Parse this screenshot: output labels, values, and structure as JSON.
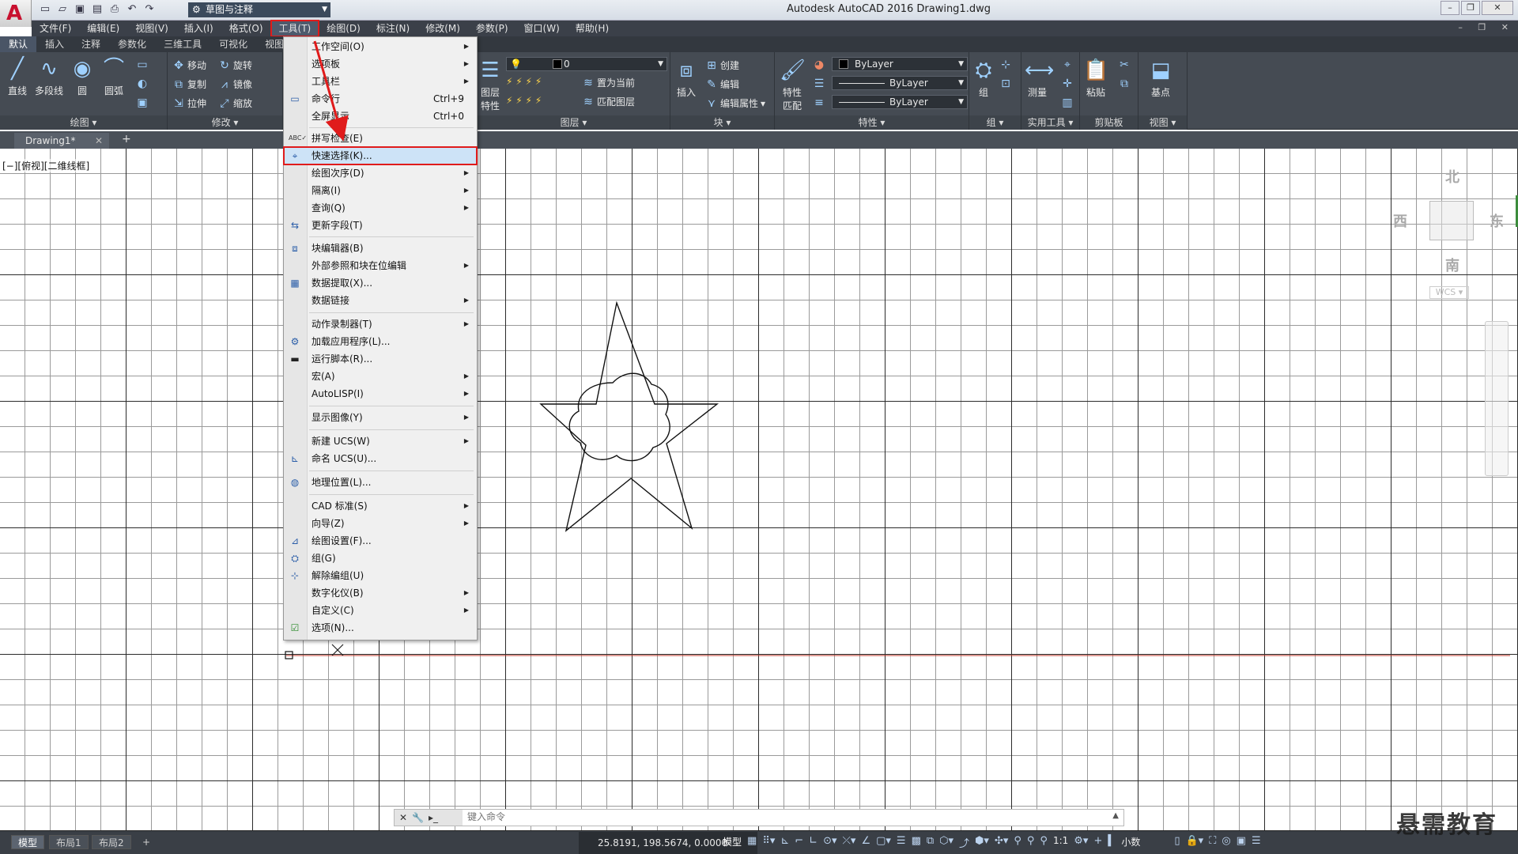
{
  "title_bar": {
    "app_title": "Autodesk AutoCAD 2016    Drawing1.dwg",
    "workspace": "草图与注释",
    "quick_access_icons": [
      "new-icon",
      "open-icon",
      "save-icon",
      "saveas-icon",
      "print-icon",
      "undo-icon",
      "redo-icon"
    ]
  },
  "menubar": [
    "文件(F)",
    "编辑(E)",
    "视图(V)",
    "插入(I)",
    "格式(O)",
    "工具(T)",
    "绘图(D)",
    "标注(N)",
    "修改(M)",
    "参数(P)",
    "窗口(W)",
    "帮助(H)"
  ],
  "ribbon_tabs": [
    "默认",
    "插入",
    "注释",
    "参数化",
    "三维工具",
    "可视化",
    "视图"
  ],
  "ribbon": {
    "draw": {
      "title": "绘图",
      "line": "直线",
      "polyline": "多段线",
      "circle": "圆",
      "arc": "圆弧"
    },
    "modify": {
      "title": "修改",
      "move": "移动",
      "rotate": "旋转",
      "copy": "复制",
      "mirror": "镜像",
      "stretch": "拉伸",
      "scale": "缩放"
    },
    "layers": {
      "title": "图层",
      "layer_props_1": "图层",
      "layer_props_2": "特性",
      "layer_value": "0",
      "set_current": "置为当前",
      "match_layer": "匹配图层"
    },
    "block": {
      "title": "块",
      "insert": "插入",
      "create": "创建",
      "edit": "编辑",
      "edit_attr": "编辑属性"
    },
    "properties": {
      "title": "特性",
      "match_1": "特性",
      "match_2": "匹配",
      "color": "ByLayer",
      "linetype": "ByLayer",
      "lineweight": "ByLayer"
    },
    "groups": {
      "title": "组",
      "group": "组"
    },
    "utilities": {
      "title": "实用工具",
      "measure": "测量"
    },
    "clipboard": {
      "title": "剪贴板",
      "paste": "粘贴"
    },
    "view": {
      "title": "视图",
      "base": "基点"
    }
  },
  "file_tabs": {
    "drawing": "Drawing1*"
  },
  "viewport_label": "[−][俯视][二维线框]",
  "tools_menu": {
    "items": [
      {
        "label": "工作空间(O)",
        "submenu": true
      },
      {
        "label": "选项板",
        "submenu": true
      },
      {
        "label": "工具栏",
        "submenu": true
      },
      {
        "label": "命令行",
        "shortcut": "Ctrl+9",
        "icon": "command-line-icon"
      },
      {
        "label": "全屏显示",
        "shortcut": "Ctrl+0"
      },
      {
        "label": "拼写检查(E)",
        "icon": "spell-check-icon"
      },
      {
        "label": "快速选择(K)...",
        "icon": "quick-select-icon",
        "highlighted": true
      },
      {
        "label": "绘图次序(D)",
        "submenu": true
      },
      {
        "label": "隔离(I)",
        "submenu": true
      },
      {
        "label": "查询(Q)",
        "submenu": true
      },
      {
        "label": "更新字段(T)",
        "icon": "update-field-icon"
      },
      {
        "label": "块编辑器(B)",
        "icon": "block-editor-icon"
      },
      {
        "label": "外部参照和块在位编辑",
        "submenu": true
      },
      {
        "label": "数据提取(X)...",
        "icon": "data-extract-icon"
      },
      {
        "label": "数据链接",
        "submenu": true
      },
      {
        "label": "动作录制器(T)",
        "submenu": true
      },
      {
        "label": "加载应用程序(L)...",
        "icon": "load-app-icon"
      },
      {
        "label": "运行脚本(R)...",
        "icon": "run-script-icon"
      },
      {
        "label": "宏(A)",
        "submenu": true
      },
      {
        "label": "AutoLISP(I)",
        "submenu": true
      },
      {
        "label": "显示图像(Y)",
        "submenu": true
      },
      {
        "label": "新建 UCS(W)",
        "submenu": true
      },
      {
        "label": "命名 UCS(U)...",
        "icon": "named-ucs-icon"
      },
      {
        "label": "地理位置(L)...",
        "icon": "geolocation-icon"
      },
      {
        "label": "CAD 标准(S)",
        "submenu": true
      },
      {
        "label": "向导(Z)",
        "submenu": true
      },
      {
        "label": "绘图设置(F)...",
        "icon": "drafting-settings-icon"
      },
      {
        "label": "组(G)",
        "icon": "group-icon"
      },
      {
        "label": "解除编组(U)",
        "icon": "ungroup-icon"
      },
      {
        "label": "数字化仪(B)",
        "submenu": true
      },
      {
        "label": "自定义(C)",
        "submenu": true
      },
      {
        "label": "选项(N)...",
        "icon": "options-icon"
      }
    ]
  },
  "viewcube": {
    "north": "北",
    "south": "南",
    "east": "东",
    "west": "西",
    "wcs": "WCS"
  },
  "command_line": {
    "placeholder": "键入命令"
  },
  "status_bar": {
    "layout_tabs": [
      "模型",
      "布局1",
      "布局2"
    ],
    "coordinates": "25.8191, 198.5674, 0.0000",
    "model": "模型",
    "scale": "1:1",
    "units": "小数"
  },
  "watermark": "悬需教育",
  "colors": {
    "accent_red": "#e01b1b",
    "ribbon_bg": "#454b53",
    "menubar_bg": "#3b4049",
    "highlight": "#cde3f7"
  }
}
